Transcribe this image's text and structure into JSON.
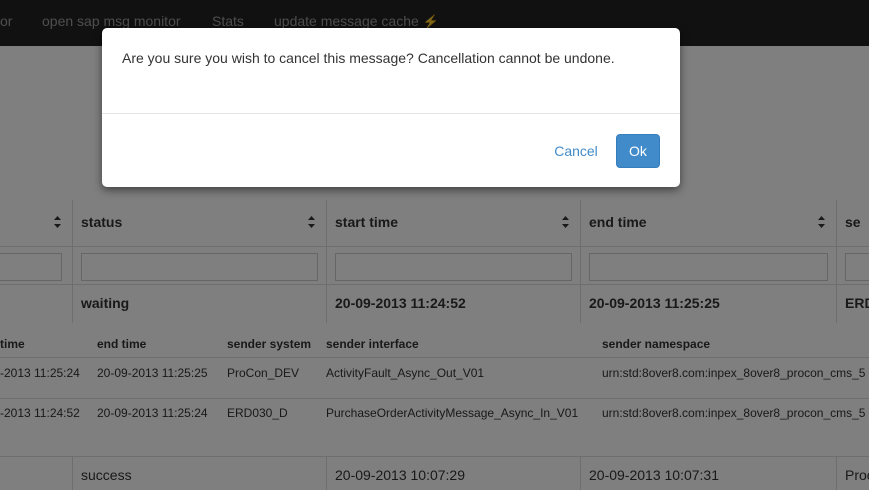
{
  "navbar": {
    "items": [
      {
        "label": "or"
      },
      {
        "label": "open sap msg monitor"
      },
      {
        "label": "Stats"
      },
      {
        "label": "update message cache"
      }
    ]
  },
  "table": {
    "columns": [
      "status",
      "start time",
      "end time",
      "se"
    ],
    "rows": [
      {
        "status": "waiting",
        "start_time": "20-09-2013 11:24:52",
        "end_time": "20-09-2013 11:25:25",
        "sender": "ERD"
      },
      {
        "status": "success",
        "start_time": "20-09-2013 10:07:29",
        "end_time": "20-09-2013 10:07:31",
        "sender": "Proc"
      }
    ]
  },
  "sub_table": {
    "columns": [
      "time",
      "end time",
      "sender system",
      "sender interface",
      "sender namespace"
    ],
    "rows": [
      {
        "start": "-2013 11:25:24",
        "end": "20-09-2013 11:25:25",
        "system": "ProCon_DEV",
        "interface": "ActivityFault_Async_Out_V01",
        "namespace": "urn:std:8over8.com:inpex_8over8_procon_cms_5"
      },
      {
        "start": "-2013 11:24:52",
        "end": "20-09-2013 11:25:24",
        "system": "ERD030_D",
        "interface": "PurchaseOrderActivityMessage_Async_In_V01",
        "namespace": "urn:std:8over8.com:inpex_8over8_procon_cms_5"
      }
    ]
  },
  "modal": {
    "message": "Are you sure you wish to cancel this message? Cancellation cannot be undone.",
    "cancel_label": "Cancel",
    "ok_label": "Ok"
  },
  "colors": {
    "navbar": "#222222",
    "accent": "#428bca",
    "backdrop": "rgba(0,0,0,0.5)"
  }
}
